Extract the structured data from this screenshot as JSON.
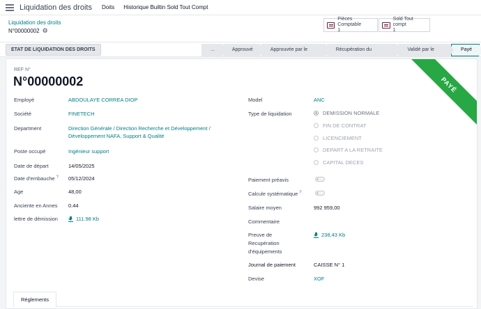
{
  "topbar": {
    "app_title": "Liquidation des droits",
    "menu": [
      "Doits",
      "Historique Builtin Sold Tout Compt"
    ]
  },
  "breadcrumb": {
    "parent": "Liquidation des droits",
    "current": "N°00000002"
  },
  "smart_buttons": [
    {
      "label": "Pièces Comptable",
      "count": "1",
      "icon": "accounting-doc-icon"
    },
    {
      "label": "Sold Tout compt",
      "count": "1",
      "icon": "accounting-doc-icon"
    }
  ],
  "statusbar": {
    "action_button": "ETAT DE LIQUIDATION DES DROITS",
    "stages": [
      "...",
      "Approuvé",
      "Approuvée par le DAF",
      "Récupération du Matériel",
      "Validé par le DG",
      "Payé"
    ],
    "current_stage": "Payé"
  },
  "ribbon": "PAYÉ",
  "form": {
    "ref_label": "REF N°",
    "ref_value": "N°00000002",
    "left": {
      "employe": {
        "label": "Employé",
        "value": "ABDOULAYE CORREA DIOP"
      },
      "societe": {
        "label": "Société",
        "value": "FINETECH"
      },
      "department": {
        "label": "Department",
        "value_line1": "Direction Générale / Direction Recherche et Développement /",
        "value_line2": "Développement NAFA, Support & Qualité"
      },
      "poste": {
        "label": "Poste occupé",
        "value": "Ingénieur support"
      },
      "date_depart": {
        "label": "Date de départ",
        "value": "14/05/2025"
      },
      "date_embauche": {
        "label": "Date d'embauche",
        "tip": "?",
        "value": "05/12/2024"
      },
      "age": {
        "label": "Age",
        "value": "48,00"
      },
      "anciente": {
        "label": "Anciente en Annes",
        "value": "0.44"
      },
      "lettre": {
        "label": "lettre de démission",
        "value": "111.98 Kb"
      }
    },
    "right": {
      "model": {
        "label": "Model",
        "value": "ANC"
      },
      "type_liquidation": {
        "label": "Type de liquidation",
        "options": [
          "DEMISSION NORMALE",
          "FIN DE CONTRAT",
          "LICENCIEMENT",
          "DEPART A LA RETRAITE",
          "CAPITAL DECES"
        ],
        "selected": "DEMISSION NORMALE"
      },
      "paiement_preavis": {
        "label": "Paiement préavis"
      },
      "calcule": {
        "label": "Calcule systématique",
        "tip": "?"
      },
      "salaire": {
        "label": "Salaire moyen",
        "value": "992 959,00"
      },
      "commentaire": {
        "label": "Commentaire"
      },
      "preuve": {
        "label_line1": "Preuve de",
        "label_line2": "Recupération",
        "label_line3": "d'équipements",
        "value": "238,43 Kb"
      },
      "journal": {
        "label": "Journal de paiement",
        "value": "CAISSE N° 1"
      },
      "devise": {
        "label": "Devise",
        "value": "XOF"
      }
    }
  },
  "tabs": [
    "Réglements"
  ]
}
